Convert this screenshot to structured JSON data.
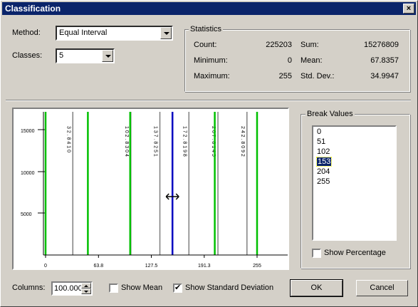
{
  "window": {
    "title": "Classification",
    "close_glyph": "×"
  },
  "method": {
    "label": "Method:",
    "value": "Equal Interval"
  },
  "classes": {
    "label": "Classes:",
    "value": "5"
  },
  "statistics": {
    "group_label": "Statistics",
    "count_label": "Count:",
    "count": "225203",
    "min_label": "Minimum:",
    "min": "0",
    "max_label": "Maximum:",
    "max": "255",
    "sum_label": "Sum:",
    "sum": "15276809",
    "mean_label": "Mean:",
    "mean": "67.8357",
    "std_label": "Std. Dev.:",
    "std": "34.9947"
  },
  "chart_data": {
    "type": "bar",
    "y_ticks": [
      "15000",
      "10000",
      "5000"
    ],
    "x_ticks": [
      "0",
      "63.8",
      "127.5",
      "191.3",
      "255"
    ],
    "mean_label": "3 2 . 8 4 1 0",
    "std_labels": [
      "1 0 2 . 8 3 0 4",
      "1 3 7 . 8 2 5 1",
      "1 7 2 . 8 1 9 8",
      "2 0 7 . 8 1 4 5",
      "2 4 2 . 8 0 9 2"
    ],
    "break_lines": [
      0,
      51,
      102,
      153,
      204,
      255
    ],
    "selected_break": 153,
    "colors": {
      "break": "#00c000",
      "selected": "#0000c0",
      "std": "#808080"
    }
  },
  "break_values": {
    "group_label": "Break Values",
    "items": [
      "0",
      "51",
      "102",
      "153",
      "204",
      "255"
    ],
    "selected_index": 3
  },
  "show_percentage": {
    "label": "Show Percentage",
    "checked": false
  },
  "columns": {
    "label": "Columns:",
    "value": "100.000"
  },
  "show_mean": {
    "label": "Show Mean",
    "checked": false
  },
  "show_std": {
    "label": "Show Standard Deviation",
    "checked": true
  },
  "buttons": {
    "ok": "OK",
    "cancel": "Cancel"
  }
}
